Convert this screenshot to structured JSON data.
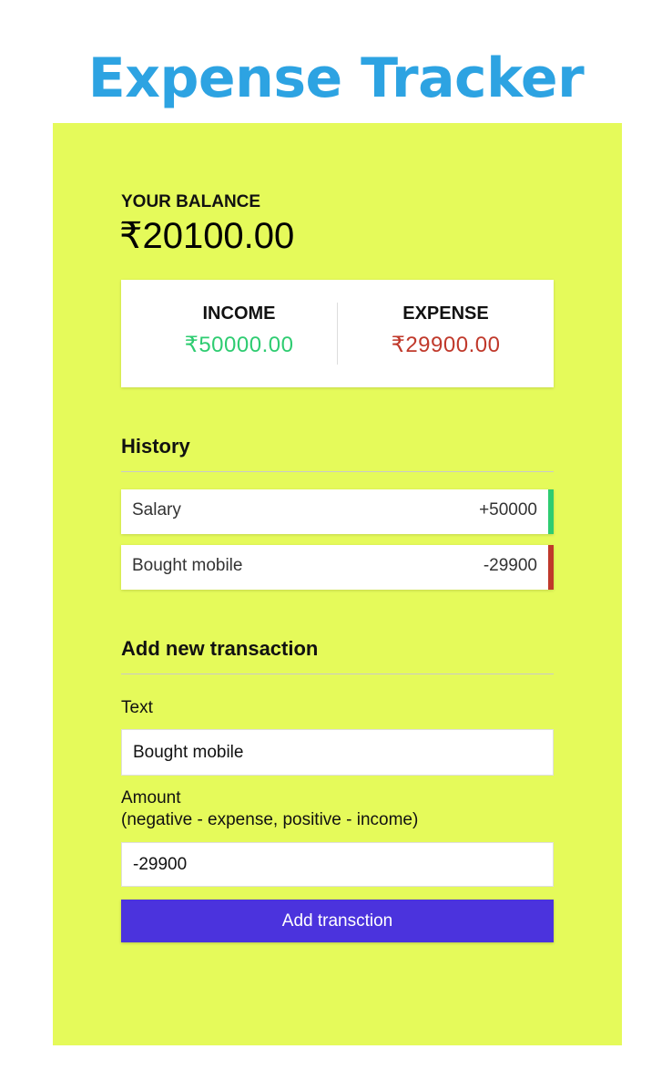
{
  "app": {
    "title": "Expense Tracker"
  },
  "balance": {
    "label": "YOUR BALANCE",
    "value": "₹20100.00"
  },
  "summary": {
    "income_label": "INCOME",
    "income_value": "₹50000.00",
    "expense_label": "EXPENSE",
    "expense_value": "₹29900.00"
  },
  "history": {
    "title": "History",
    "items": [
      {
        "text": "Salary",
        "amount": "+50000",
        "type": "income"
      },
      {
        "text": "Bought mobile",
        "amount": "-29900",
        "type": "expense"
      }
    ]
  },
  "form": {
    "title": "Add new transaction",
    "text_label": "Text",
    "text_value": "Bought mobile",
    "amount_label": "Amount",
    "amount_hint": "(negative - expense, positive - income)",
    "amount_value": "-29900",
    "submit_label": "Add transction"
  },
  "colors": {
    "title": "#2da3e2",
    "panel_background": "#e5fa5a",
    "income": "#2ecc71",
    "expense": "#c0392b",
    "button": "#4b33dd"
  }
}
